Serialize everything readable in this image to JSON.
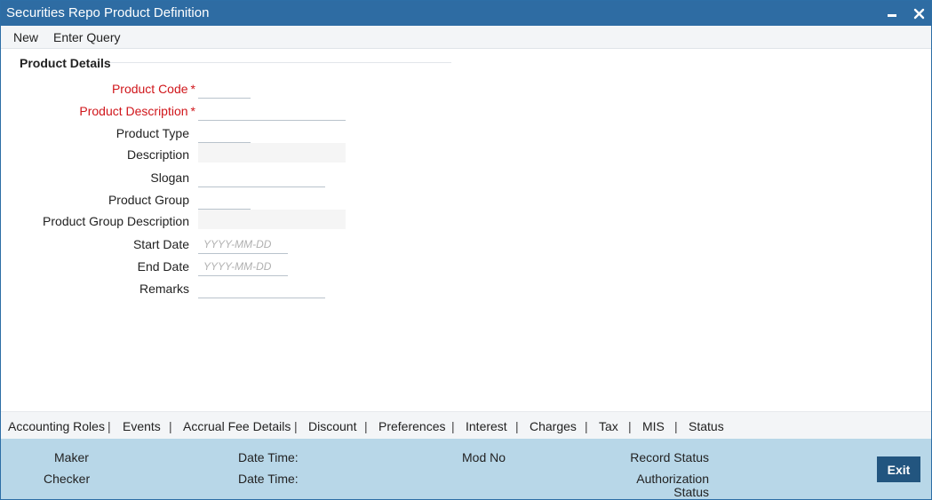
{
  "window": {
    "title": "Securities Repo Product Definition"
  },
  "menu": {
    "new": "New",
    "enter_query": "Enter Query"
  },
  "section": {
    "title": "Product Details"
  },
  "form": {
    "required_mark": "*",
    "product_code": {
      "label": "Product Code",
      "value": ""
    },
    "product_description": {
      "label": "Product Description",
      "value": ""
    },
    "product_type": {
      "label": "Product Type",
      "value": ""
    },
    "description": {
      "label": "Description",
      "value": ""
    },
    "slogan": {
      "label": "Slogan",
      "value": ""
    },
    "product_group": {
      "label": "Product Group",
      "value": ""
    },
    "product_group_description": {
      "label": "Product Group Description",
      "value": ""
    },
    "start_date": {
      "label": "Start Date",
      "value": "",
      "placeholder": "YYYY-MM-DD"
    },
    "end_date": {
      "label": "End Date",
      "value": "",
      "placeholder": "YYYY-MM-DD"
    },
    "remarks": {
      "label": "Remarks",
      "value": ""
    }
  },
  "tabs": [
    "Accounting Roles",
    "Events",
    "Accrual Fee Details",
    "Discount",
    "Preferences",
    "Interest",
    "Charges",
    "Tax",
    "MIS",
    "Status"
  ],
  "tab_separator": "|",
  "footer": {
    "maker": "Maker",
    "checker": "Checker",
    "date_time_1": "Date Time:",
    "date_time_2": "Date Time:",
    "mod_no": "Mod No",
    "record_status": "Record Status",
    "authorization": "Authorization",
    "status": "Status",
    "exit": "Exit"
  },
  "colors": {
    "titlebar": "#2e6ca3",
    "footer": "#b8d7e8",
    "exit_button": "#22557f",
    "required": "#d0161b"
  }
}
